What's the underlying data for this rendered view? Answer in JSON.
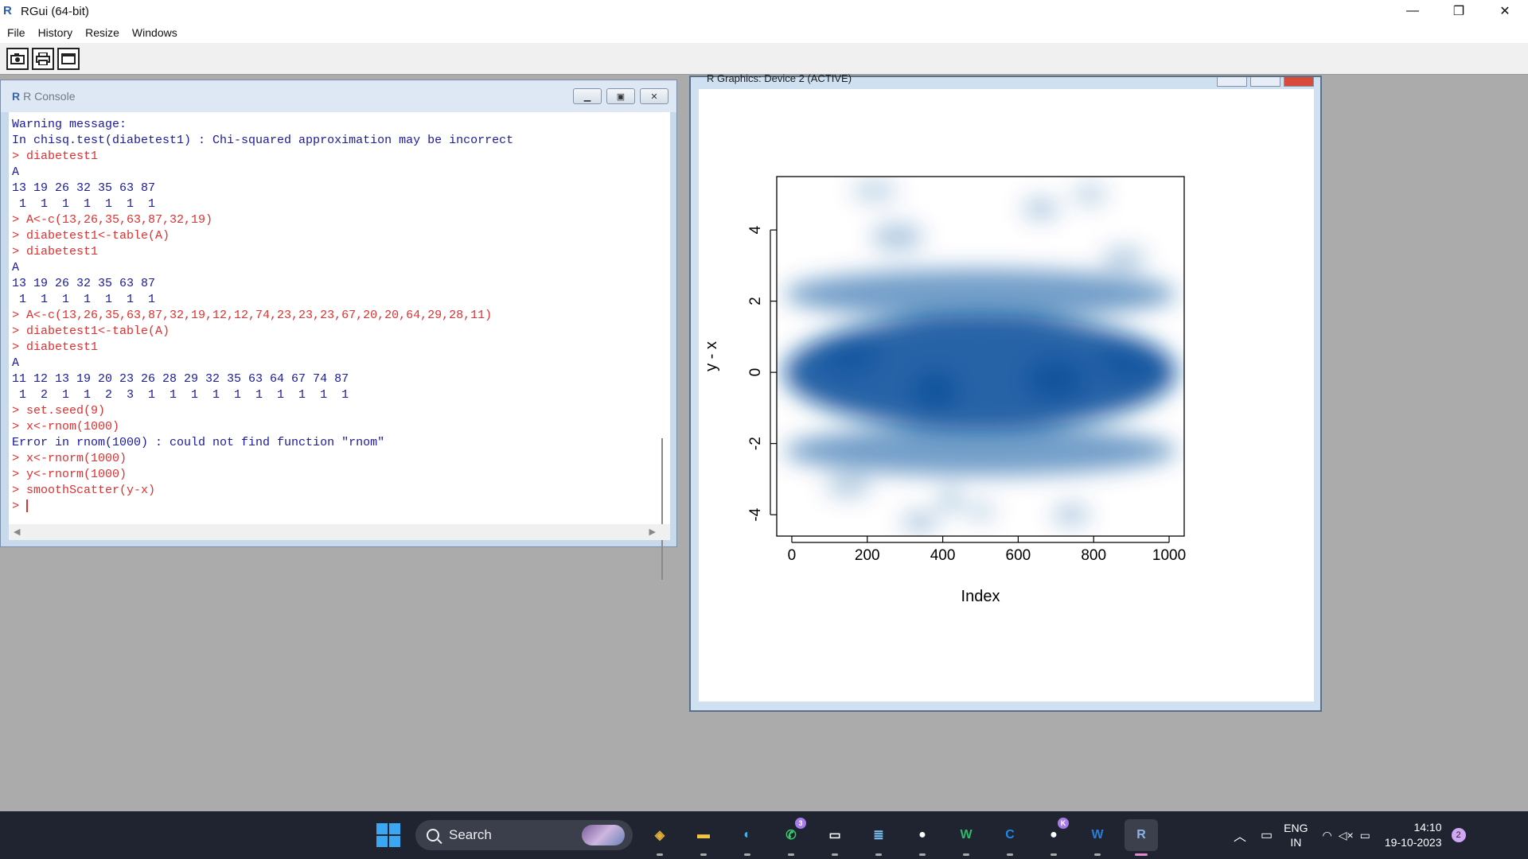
{
  "app": {
    "title": "RGui (64-bit)",
    "window_controls": [
      "—",
      "❐",
      "✕"
    ]
  },
  "menu": [
    "File",
    "History",
    "Resize",
    "Windows"
  ],
  "toolbar": {
    "buttons": [
      "camera-icon",
      "print-icon",
      "window-icon"
    ]
  },
  "console": {
    "title": "R Console",
    "lines": [
      {
        "type": "out",
        "text": "Warning message:"
      },
      {
        "type": "out",
        "text": "In chisq.test(diabetest1) : Chi-squared approximation may be incorrect"
      },
      {
        "type": "cmd",
        "text": "> diabetest1"
      },
      {
        "type": "out",
        "text": "A"
      },
      {
        "type": "out",
        "text": "13 19 26 32 35 63 87"
      },
      {
        "type": "out",
        "text": " 1  1  1  1  1  1  1"
      },
      {
        "type": "cmd",
        "text": "> A<-c(13,26,35,63,87,32,19)"
      },
      {
        "type": "cmd",
        "text": "> diabetest1<-table(A)"
      },
      {
        "type": "cmd",
        "text": "> diabetest1"
      },
      {
        "type": "out",
        "text": "A"
      },
      {
        "type": "out",
        "text": "13 19 26 32 35 63 87"
      },
      {
        "type": "out",
        "text": " 1  1  1  1  1  1  1"
      },
      {
        "type": "cmd",
        "text": "> A<-c(13,26,35,63,87,32,19,12,12,74,23,23,23,67,20,20,64,29,28,11)"
      },
      {
        "type": "cmd",
        "text": "> diabetest1<-table(A)"
      },
      {
        "type": "cmd",
        "text": "> diabetest1"
      },
      {
        "type": "out",
        "text": "A"
      },
      {
        "type": "out",
        "text": "11 12 13 19 20 23 26 28 29 32 35 63 64 67 74 87"
      },
      {
        "type": "out",
        "text": " 1  2  1  1  2  3  1  1  1  1  1  1  1  1  1  1"
      },
      {
        "type": "cmd",
        "text": "> set.seed(9)"
      },
      {
        "type": "cmd",
        "text": "> x<-rnom(1000)"
      },
      {
        "type": "out",
        "text": "Error in rnom(1000) : could not find function \"rnom\""
      },
      {
        "type": "cmd",
        "text": "> x<-rnorm(1000)"
      },
      {
        "type": "cmd",
        "text": "> y<-rnorm(1000)"
      },
      {
        "type": "cmd",
        "text": "> smoothScatter(y-x)"
      }
    ],
    "prompt": "> "
  },
  "graphics": {
    "title": "R Graphics: Device 2 (ACTIVE)"
  },
  "chart_data": {
    "type": "heatmap",
    "subtype": "smoothScatter density",
    "xlabel": "Index",
    "ylabel": "y - x",
    "xticks": [
      0,
      200,
      400,
      600,
      800,
      1000
    ],
    "yticks": [
      -4,
      -2,
      0,
      2,
      4
    ],
    "xlim": [
      -40,
      1040
    ],
    "ylim": [
      -4.6,
      5.5
    ],
    "color": "#08519c",
    "grid": false,
    "density_blobs": [
      {
        "x": 500,
        "y": 0,
        "rx": 520,
        "ry": 1.6,
        "a": 0.9
      },
      {
        "x": 380,
        "y": -0.5,
        "rx": 60,
        "ry": 0.5,
        "a": 0.9
      },
      {
        "x": 700,
        "y": -0.2,
        "rx": 80,
        "ry": 0.6,
        "a": 0.8
      },
      {
        "x": 150,
        "y": 0.5,
        "rx": 80,
        "ry": 0.6,
        "a": 0.6
      },
      {
        "x": 900,
        "y": 0.3,
        "rx": 90,
        "ry": 0.6,
        "a": 0.6
      },
      {
        "x": 500,
        "y": 2.2,
        "rx": 520,
        "ry": 0.7,
        "a": 0.55
      },
      {
        "x": 500,
        "y": -2.2,
        "rx": 520,
        "ry": 0.7,
        "a": 0.55
      },
      {
        "x": 220,
        "y": 5.1,
        "rx": 60,
        "ry": 0.3,
        "a": 0.25
      },
      {
        "x": 660,
        "y": 4.6,
        "rx": 50,
        "ry": 0.3,
        "a": 0.3
      },
      {
        "x": 790,
        "y": 5.0,
        "rx": 45,
        "ry": 0.3,
        "a": 0.25
      },
      {
        "x": 280,
        "y": 3.8,
        "rx": 70,
        "ry": 0.4,
        "a": 0.3
      },
      {
        "x": 420,
        "y": -3.6,
        "rx": 30,
        "ry": 0.3,
        "a": 0.35
      },
      {
        "x": 340,
        "y": -4.2,
        "rx": 50,
        "ry": 0.3,
        "a": 0.3
      },
      {
        "x": 740,
        "y": -4.0,
        "rx": 50,
        "ry": 0.3,
        "a": 0.3
      },
      {
        "x": 500,
        "y": -3.9,
        "rx": 40,
        "ry": 0.25,
        "a": 0.25
      },
      {
        "x": 150,
        "y": -3.2,
        "rx": 60,
        "ry": 0.3,
        "a": 0.3
      },
      {
        "x": 880,
        "y": 3.2,
        "rx": 60,
        "ry": 0.3,
        "a": 0.3
      }
    ]
  },
  "taskbar": {
    "search_label": "Search",
    "apps": [
      {
        "name": "gallery-app",
        "glyph": "◈",
        "color": "#e0b03a"
      },
      {
        "name": "file-explorer",
        "glyph": "▬",
        "color": "#f4c542"
      },
      {
        "name": "edge-browser",
        "glyph": "◐",
        "color": "#3fb4e8"
      },
      {
        "name": "whatsapp",
        "glyph": "✆",
        "color": "#37d167",
        "badge": "3"
      },
      {
        "name": "terminal",
        "glyph": "▭",
        "color": "#ffffff"
      },
      {
        "name": "notepad",
        "glyph": "≣",
        "color": "#7ec3f5"
      },
      {
        "name": "github",
        "glyph": "●",
        "color": "#ffffff"
      },
      {
        "name": "wps-writer",
        "glyph": "W",
        "color": "#2fb86b"
      },
      {
        "name": "c-app",
        "glyph": "C",
        "color": "#1e88e5"
      },
      {
        "name": "github-desktop",
        "glyph": "●",
        "color": "#ffffff",
        "badge": "K"
      },
      {
        "name": "word",
        "glyph": "W",
        "color": "#2b7cd3"
      },
      {
        "name": "rgui",
        "glyph": "R",
        "color": "#8ab4e8",
        "active": true
      }
    ],
    "lang_top": "ENG",
    "lang_bottom": "IN",
    "time": "14:10",
    "date": "19-10-2023",
    "notifications": "2"
  }
}
